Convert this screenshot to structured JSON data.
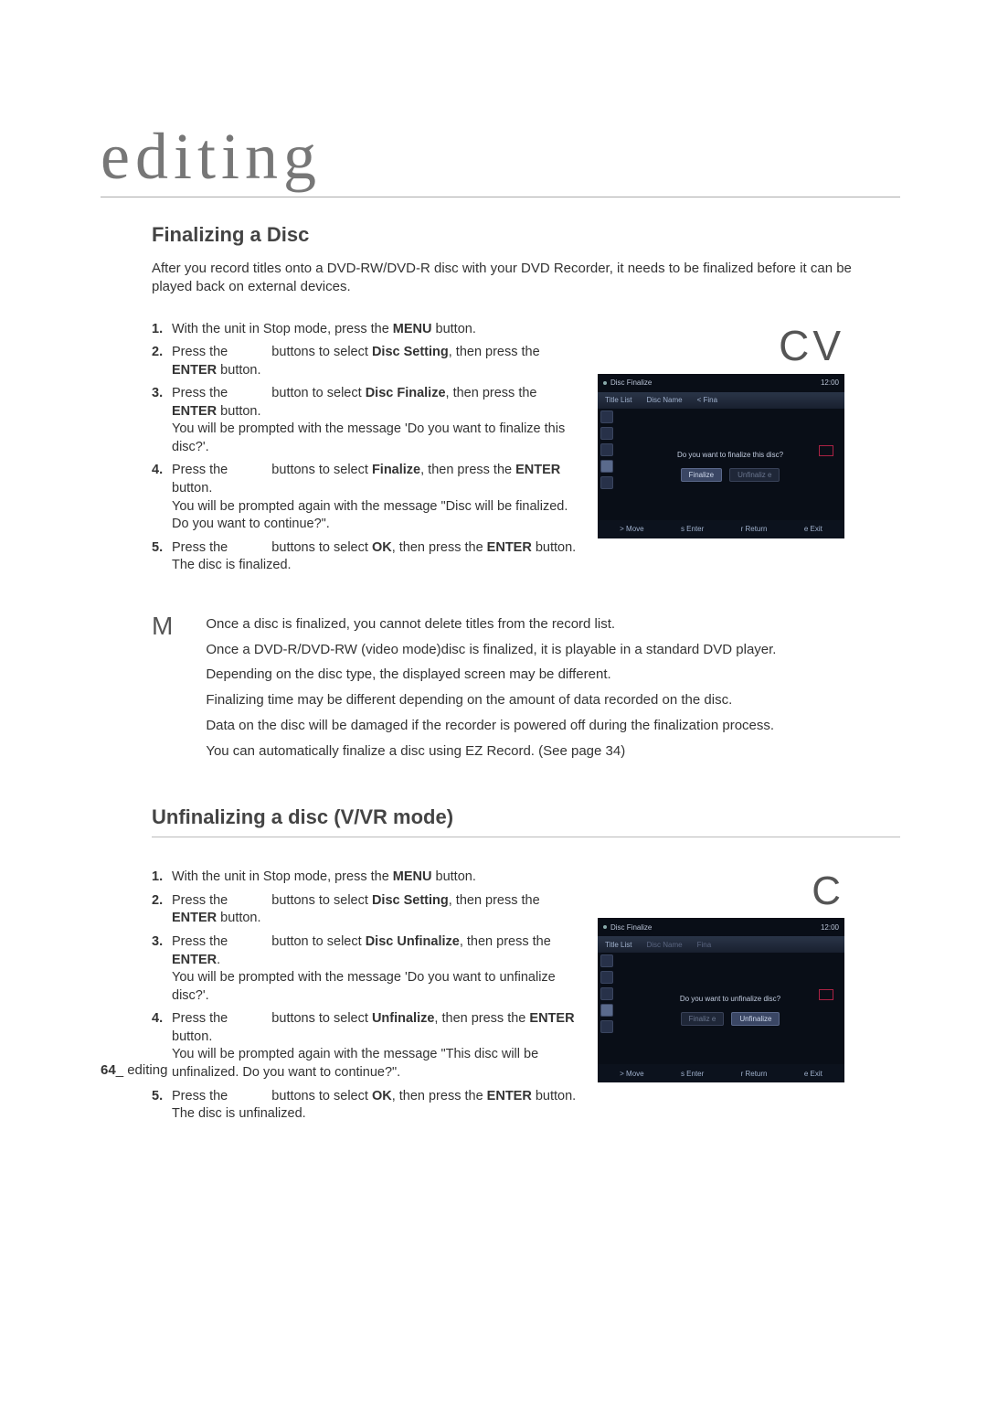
{
  "header": "editing",
  "section1": {
    "title": "Finalizing a Disc",
    "intro": "After you record titles onto a DVD-RW/DVD-R disc with your DVD Recorder, it needs to be finalized before it can be played back on external devices.",
    "badge": "CV",
    "steps": [
      {
        "n": "1.",
        "pre": " With the unit in Stop mode, press the ",
        "b1": "MENU",
        "post": " button."
      },
      {
        "n": "2.",
        "pre": " Press the ",
        "gap": true,
        "mid": " buttons to select ",
        "b1": "Disc Setting",
        "post2": ", then press the ",
        "b2": "ENTER",
        "post3": " button."
      },
      {
        "n": "3.",
        "pre": " Press the ",
        "gap": true,
        "mid": " button to select ",
        "b1": "Disc Finalize",
        "post2": ", then press the ",
        "b2": "ENTER",
        "post3": " button.",
        "extra": "You will be prompted with the message 'Do you want to finalize this disc?'."
      },
      {
        "n": "4.",
        "pre": " Press the ",
        "gap": true,
        "mid": " buttons to select ",
        "b1": "Finalize",
        "post2": ", then press the ",
        "b2": "ENTER",
        "post3": " button.",
        "extra": "You will be prompted again with the message \"Disc will be finalized. Do you want to continue?\"."
      },
      {
        "n": "5.",
        "pre": " Press the ",
        "gap": true,
        "mid": " buttons to select ",
        "b1": "OK",
        "post2": ", then press the ",
        "b2": "ENTER",
        "post3": " button.",
        "extra": "The disc is finalized."
      }
    ]
  },
  "osd1": {
    "title": "Disc Finalize",
    "time": "12:00",
    "tabs": [
      "Title List",
      "Disc Name",
      "< Fina"
    ],
    "question": "Do you want to finalize this disc?",
    "btn1": "Finalize",
    "btn2": "Unfinaliz e",
    "foot": [
      "> Move",
      "s  Enter",
      "r  Return",
      "e  Exit"
    ]
  },
  "notes": {
    "m": "M",
    "lines": [
      "Once a disc is ﬁnalized, you cannot delete titles from the record list.",
      "Once a DVD-R/DVD-RW (video mode)disc is ﬁnalized, it is playable in a standard DVD player.",
      "Depending on the disc type, the displayed screen may be different.",
      "Finalizing time may be different depending on the amount of data recorded on the disc.",
      "Data on the disc will be damaged if the recorder is powered off during the ﬁnalization process.",
      "You can automatically ﬁnalize a disc using EZ Record. (See page 34)"
    ]
  },
  "section2": {
    "title": "Unfinalizing a disc (V/VR mode)",
    "badge": "C",
    "steps": [
      {
        "n": "1.",
        "pre": " With the unit in Stop mode, press the ",
        "b1": "MENU",
        "post": " button."
      },
      {
        "n": "2.",
        "pre": " Press the ",
        "gap": true,
        "mid": " buttons to select ",
        "b1": "Disc Setting",
        "post2": ", then press the ",
        "b2": "ENTER",
        "post3": " button."
      },
      {
        "n": "3.",
        "pre": " Press the ",
        "gap": true,
        "mid": " button to select ",
        "b1": "Disc Unfinalize",
        "post2": ", then press the ",
        "b2": "ENTER",
        "post3": ".",
        "extra": "You will be prompted with the message 'Do you want to unfinalize disc?'."
      },
      {
        "n": "4.",
        "pre": " Press the ",
        "gap": true,
        "mid": " buttons to select ",
        "b1": "Unfinalize",
        "post2": ", then press the ",
        "b2": "ENTER",
        "post3": " button.",
        "extra": "You will be prompted again with the message \"This disc will be unfinalized. Do you want to continue?\"."
      },
      {
        "n": "5.",
        "pre": " Press the ",
        "gap": true,
        "mid": " buttons to select ",
        "b1": "OK",
        "post2": ", then press the ",
        "b2": "ENTER",
        "post3": " button.",
        "extra": "The disc is unfinalized."
      }
    ]
  },
  "osd2": {
    "title": "Disc Finalize",
    "time": "12:00",
    "tabs": [
      "Title List",
      "Disc Name",
      "Fina"
    ],
    "question": "Do you want to unfinalize disc?",
    "btn1": "Finaliz e",
    "btn2": "Unfinalize",
    "foot": [
      "> Move",
      "s  Enter",
      "r  Return",
      "e  Exit"
    ]
  },
  "footer": {
    "page": "64",
    "sep": "_ ",
    "label": "editing"
  }
}
